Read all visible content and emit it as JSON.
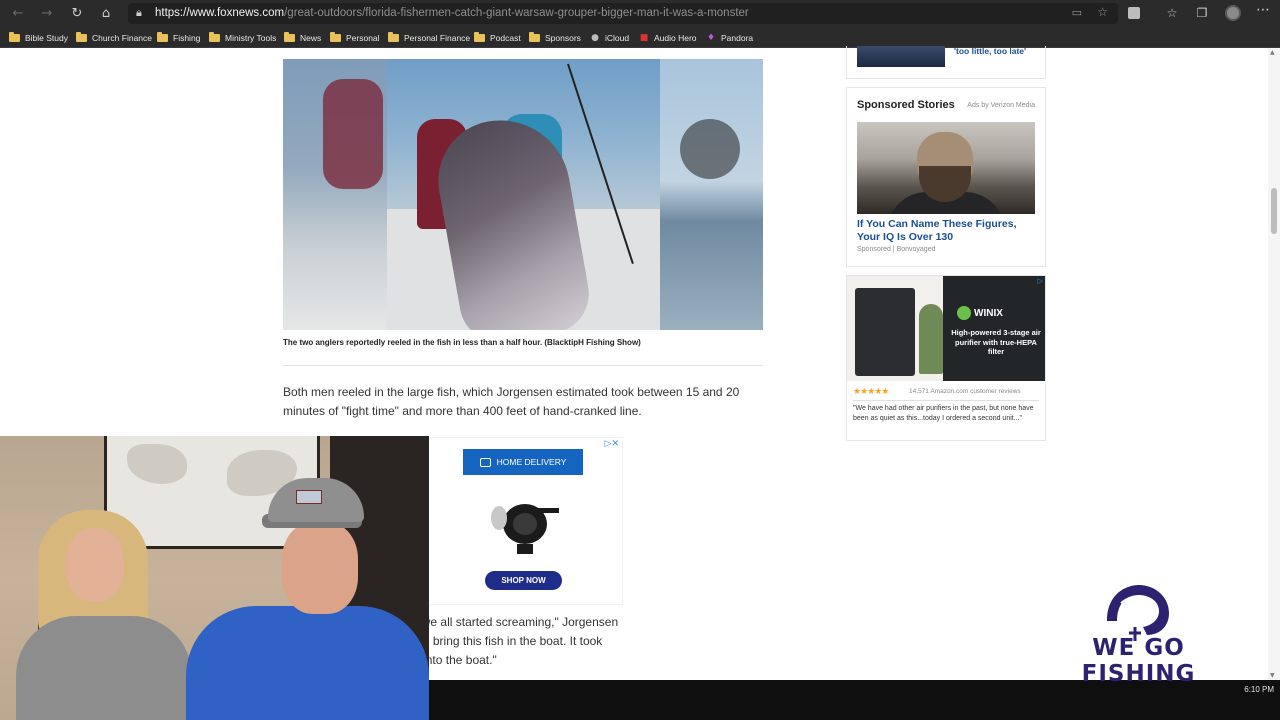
{
  "browser": {
    "url_host": "https://www.foxnews.com",
    "url_path": "/great-outdoors/florida-fishermen-catch-giant-warsaw-grouper-bigger-man-it-was-a-monster",
    "nav_icons": [
      "back-icon",
      "forward-icon",
      "reload-icon",
      "home-icon"
    ]
  },
  "bookmarks": [
    {
      "label": "Bible Study",
      "icon": "folder-icon"
    },
    {
      "label": "Church Finance",
      "icon": "folder-icon"
    },
    {
      "label": "Fishing",
      "icon": "folder-icon"
    },
    {
      "label": "Ministry Tools",
      "icon": "folder-icon"
    },
    {
      "label": "News",
      "icon": "folder-icon"
    },
    {
      "label": "Personal",
      "icon": "folder-icon"
    },
    {
      "label": "Personal Finance",
      "icon": "folder-icon"
    },
    {
      "label": "Podcast",
      "icon": "folder-icon"
    },
    {
      "label": "Sponsors",
      "icon": "folder-icon"
    },
    {
      "label": "iCloud",
      "icon": "apple-icon"
    },
    {
      "label": "Audio Hero",
      "icon": "audio-hero-icon"
    },
    {
      "label": "Pandora",
      "icon": "pandora-icon"
    }
  ],
  "article": {
    "caption": "The two anglers reportedly reeled in the fish in less than a half hour. (BlacktipH Fishing Show)",
    "para1": "Both men reeled in the large fish, which Jorgensen estimated took between 15 and 20 minutes of \"fight time\" and more than 400 feet of hand-cranked line.",
    "para2_line1": "floated to the surface and we all started screaming,\" Jorgensen",
    "para2_line2": "e how difficult it would be to bring this fish in the boat. It took",
    "para2_line3": "sh over the gunwales and into the boat.\""
  },
  "inline_ad": {
    "delivery_label": "HOME DELIVERY",
    "shop_label": "SHOP NOW"
  },
  "sidebar": {
    "top_link": "'too little, too late'",
    "sponsored_heading": "Sponsored Stories",
    "ads_by": "Ads by Verizon Media",
    "story_title": "If You Can Name These Figures, Your IQ Is Over 130",
    "story_source": "Sponsored | Bonvoyaged",
    "winix_brand": "WINIX",
    "winix_tagline": "High-powered 3-stage air purifier with true-HEPA filter",
    "winix_stars": "★★★★★",
    "winix_reviews": "14,571 Amazon.com customer reviews",
    "winix_quote": "\"We have had other air purifiers in the past, but none have been as quiet as this...today I ordered a second unit...\""
  },
  "watermark": {
    "text": "WE GO FISHING"
  },
  "taskbar": {
    "time": "6:10 PM"
  },
  "colors": {
    "link_blue": "#1a4f94",
    "ad_blue": "#1565c0",
    "logo_purple": "#2d2270"
  }
}
